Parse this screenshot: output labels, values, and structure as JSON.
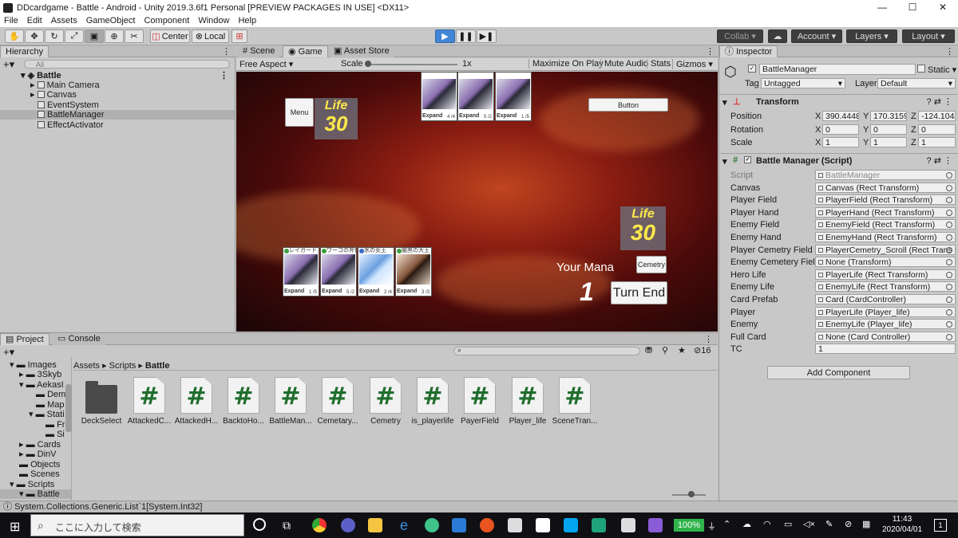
{
  "window": {
    "title": "DDcardgame - Battle - Android - Unity 2019.3.6f1 Personal [PREVIEW PACKAGES IN USE] <DX11>"
  },
  "menu": [
    "File",
    "Edit",
    "Assets",
    "GameObject",
    "Component",
    "Window",
    "Help"
  ],
  "toolbar": {
    "center": "Center",
    "local": "Local",
    "collab": "Collab",
    "account": "Account",
    "layers": "Layers",
    "layout": "Layout"
  },
  "hierarchy": {
    "tab": "Hierarchy",
    "search_placeholder": "All",
    "scene": "Battle",
    "items": [
      "Main Camera",
      "Canvas",
      "EventSystem",
      "BattleManager",
      "EffectActivator"
    ]
  },
  "views": {
    "tabs": [
      "Scene",
      "Game",
      "Asset Store"
    ],
    "aspect": "Free Aspect",
    "scale_label": "Scale",
    "scale_value": "1x",
    "options": [
      "Maximize On Play",
      "Mute Audio",
      "Stats",
      "Gizmos"
    ]
  },
  "game": {
    "menu_button": "Menu",
    "top_button": "Button",
    "enemy_life_label": "Life",
    "enemy_life": "30",
    "player_life_label": "Life",
    "player_life": "30",
    "mana_label": "Your Mana",
    "mana_value": "1",
    "cemetry_button": "Cemetry",
    "turn_end_button": "Turn End",
    "enemy_cards": [
      {
        "expand": "Expand",
        "stats": "4 /4"
      },
      {
        "expand": "Expand",
        "stats": "5 /2"
      },
      {
        "expand": "Expand",
        "stats": "1 /5"
      }
    ],
    "player_cards": [
      {
        "name": "レイガード",
        "expand": "Expand",
        "stats": "1 /5"
      },
      {
        "name": "ワーゴの斧使い",
        "expand": "Expand",
        "stats": "5 /2"
      },
      {
        "name": "氷の女王",
        "expand": "Expand",
        "stats": "2 /4"
      },
      {
        "name": "闇黒の大王",
        "expand": "Expand",
        "stats": "3 /3"
      }
    ]
  },
  "inspector": {
    "tab": "Inspector",
    "object_name": "BattleManager",
    "static_label": "Static",
    "tag_label": "Tag",
    "tag_value": "Untagged",
    "layer_label": "Layer",
    "layer_value": "Default",
    "transform": {
      "title": "Transform",
      "position": {
        "label": "Position",
        "x": "390.4448",
        "y": "170.3159",
        "z": "-124.104"
      },
      "rotation": {
        "label": "Rotation",
        "x": "0",
        "y": "0",
        "z": "0"
      },
      "scale": {
        "label": "Scale",
        "x": "1",
        "y": "1",
        "z": "1"
      }
    },
    "script_component": {
      "title": "Battle Manager (Script)",
      "fields": [
        {
          "label": "Script",
          "value": "BattleManager"
        },
        {
          "label": "Canvas",
          "value": "Canvas (Rect Transform)"
        },
        {
          "label": "Player Field",
          "value": "PlayerField (Rect Transform)"
        },
        {
          "label": "Player Hand",
          "value": "PlayerHand (Rect Transform)"
        },
        {
          "label": "Enemy Field",
          "value": "EnemyField (Rect Transform)"
        },
        {
          "label": "Enemy Hand",
          "value": "EnemyHand (Rect Transform)"
        },
        {
          "label": "Player Cemetry Field",
          "value": "PlayerCemetry_Scroll (Rect Trans"
        },
        {
          "label": "Enemy Cemetery Field",
          "value": "None (Transform)"
        },
        {
          "label": "Hero Life",
          "value": "PlayerLife (Rect Transform)"
        },
        {
          "label": "Enemy Life",
          "value": "EnemyLife (Rect Transform)"
        },
        {
          "label": "Card Prefab",
          "value": "Card (CardController)"
        },
        {
          "label": "Player",
          "value": "PlayerLife (Player_life)"
        },
        {
          "label": "Enemy",
          "value": "EnemyLife (Player_life)"
        },
        {
          "label": "Full Card",
          "value": "None (Card Controller)"
        },
        {
          "label": "TC",
          "value": "1"
        }
      ]
    },
    "add_component": "Add Component"
  },
  "project": {
    "tabs": [
      "Project",
      "Console"
    ],
    "breadcrumb": [
      "Assets",
      "Scripts",
      "Battle"
    ],
    "hidden_count": "16",
    "tree": [
      "Images",
      "3Skyb",
      "AekasI",
      "Dem",
      "Map",
      "Stati",
      "Fr",
      "Si",
      "Cards",
      "DinV",
      "Objects",
      "Scenes",
      "Scripts",
      "Battle"
    ],
    "assets": [
      "DeckSelect",
      "AttackedC...",
      "AttackedH...",
      "BacktoHo...",
      "BattleMan...",
      "Cemetary...",
      "Cemetry",
      "is_playerlife",
      "PayerField",
      "Player_life",
      "SceneTran..."
    ]
  },
  "status": {
    "message": "System.Collections.Generic.List`1[System.Int32]"
  },
  "taskbar": {
    "search_placeholder": "ここに入力して検索",
    "battery": "100%",
    "time": "11:43",
    "date": "2020/04/01",
    "notifications": "1"
  }
}
